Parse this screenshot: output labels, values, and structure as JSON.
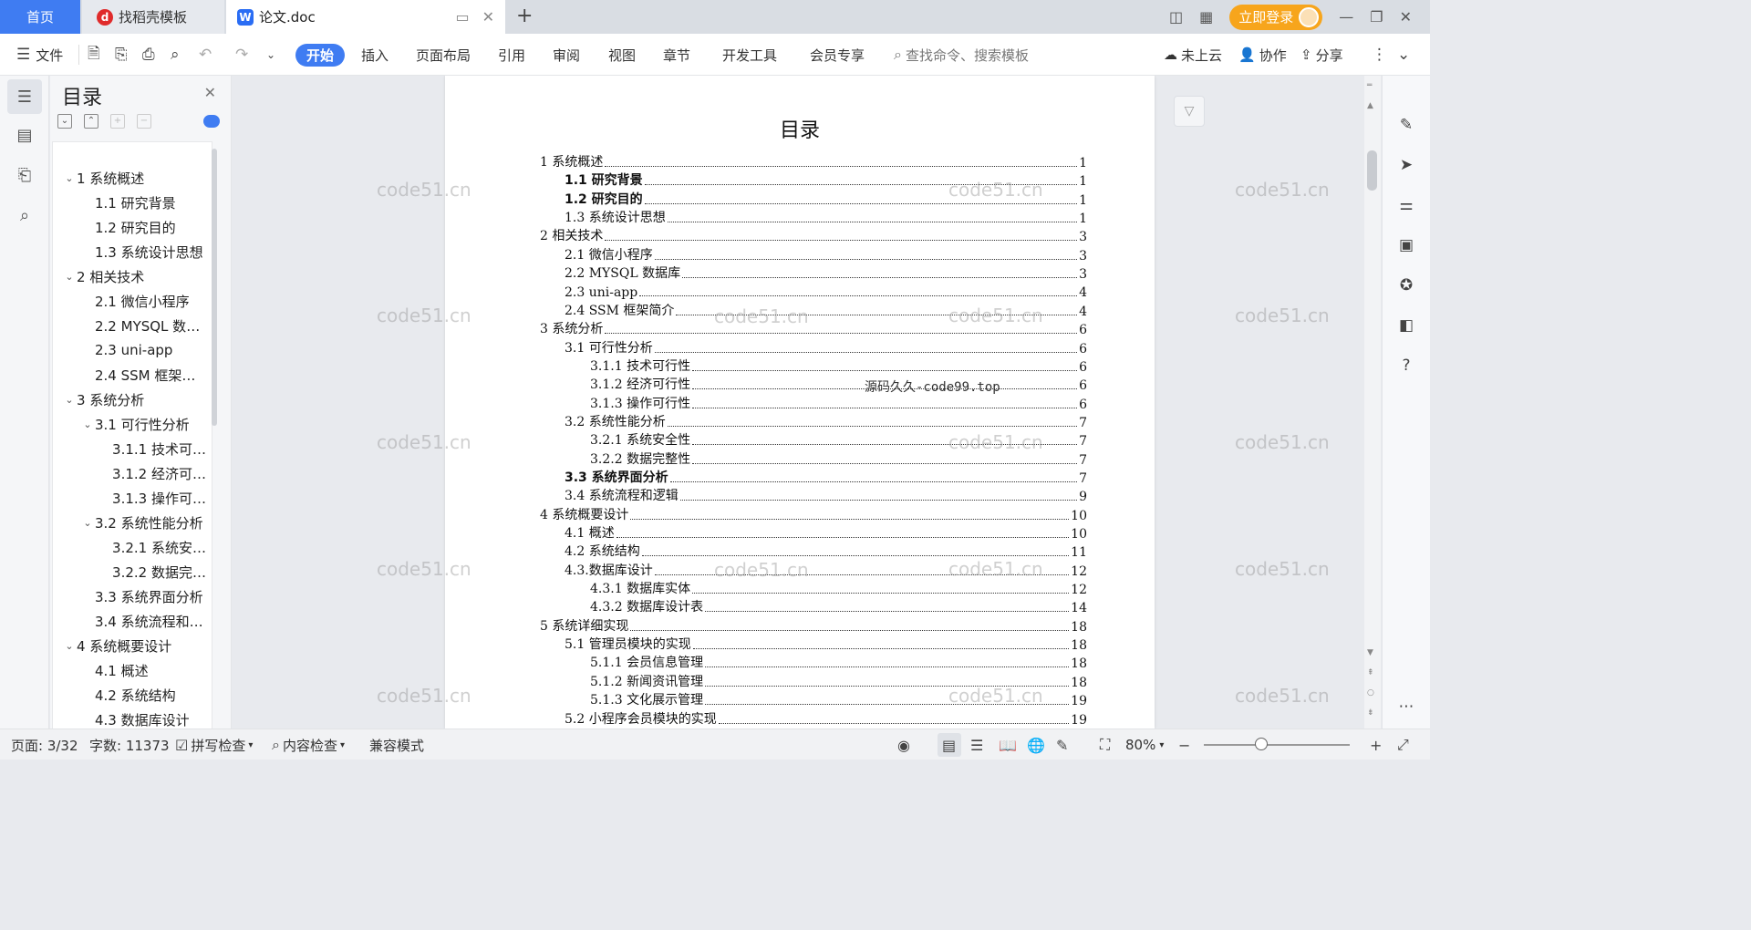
{
  "tabs": {
    "home": "首页",
    "template": "找稻壳模板",
    "doc": "论文.doc",
    "login": "立即登录"
  },
  "toolbar": {
    "file": "文件",
    "menus": [
      "开始",
      "插入",
      "页面布局",
      "引用",
      "审阅",
      "视图",
      "章节",
      "开发工具",
      "会员专享"
    ],
    "search_placeholder": "查找命令、搜索模板",
    "cloud": "未上云",
    "collab": "协作",
    "share": "分享"
  },
  "toc_panel": {
    "title": "目录",
    "items": [
      {
        "label": "1 系统概述",
        "level": 1,
        "expanded": true
      },
      {
        "label": "1.1  研究背景",
        "level": 2
      },
      {
        "label": "1.2 研究目的",
        "level": 2
      },
      {
        "label": "1.3 系统设计思想",
        "level": 2
      },
      {
        "label": "2 相关技术",
        "level": 1,
        "expanded": true
      },
      {
        "label": "2.1 微信小程序",
        "level": 2
      },
      {
        "label": "2.2 MYSQL 数据库",
        "level": 2
      },
      {
        "label": "2.3 uni-app",
        "level": 2
      },
      {
        "label": "2.4 SSM 框架简介",
        "level": 2
      },
      {
        "label": "3 系统分析",
        "level": 1,
        "expanded": true
      },
      {
        "label": "3.1 可行性分析",
        "level": 2,
        "expanded": true
      },
      {
        "label": "3.1.1 技术可行性",
        "level": 3
      },
      {
        "label": "3.1.2 经济可行性",
        "level": 3
      },
      {
        "label": "3.1.3 操作可行性",
        "level": 3
      },
      {
        "label": "3.2 系统性能分析",
        "level": 2,
        "expanded": true
      },
      {
        "label": "3.2.1  系统安全性",
        "level": 3
      },
      {
        "label": "3.2.2  数据完整性",
        "level": 3
      },
      {
        "label": "3.3 系统界面分析",
        "level": 2
      },
      {
        "label": "3.4 系统流程和逻辑",
        "level": 2
      },
      {
        "label": "4 系统概要设计",
        "level": 1,
        "expanded": true
      },
      {
        "label": "4.1 概述",
        "level": 2
      },
      {
        "label": "4.2 系统结构",
        "level": 2
      },
      {
        "label": "4.3 数据库设计",
        "level": 2
      }
    ]
  },
  "document": {
    "title": "目录",
    "entries": [
      {
        "text": "1 系统概述",
        "page": "1",
        "indent": 0,
        "bold": false
      },
      {
        "text": "1.1  研究背景",
        "page": "1",
        "indent": 1,
        "bold": true
      },
      {
        "text": "1.2 研究目的",
        "page": "1",
        "indent": 1,
        "bold": true
      },
      {
        "text": "1.3 系统设计思想",
        "page": "1",
        "indent": 1,
        "bold": false
      },
      {
        "text": "2 相关技术",
        "page": "3",
        "indent": 0,
        "bold": false
      },
      {
        "text": "2.1 微信小程序",
        "page": "3",
        "indent": 1,
        "bold": false
      },
      {
        "text": "2.2 MYSQL 数据库",
        "page": "3",
        "indent": 1,
        "bold": false
      },
      {
        "text": "2.3 uni-app",
        "page": "4",
        "indent": 1,
        "bold": false
      },
      {
        "text": "2.4 SSM 框架简介",
        "page": "4",
        "indent": 1,
        "bold": false
      },
      {
        "text": "3 系统分析",
        "page": "6",
        "indent": 0,
        "bold": false
      },
      {
        "text": "3.1 可行性分析",
        "page": "6",
        "indent": 1,
        "bold": false
      },
      {
        "text": "3.1.1 技术可行性",
        "page": "6",
        "indent": 2,
        "bold": false
      },
      {
        "text": "3.1.2 经济可行性",
        "page": "6",
        "indent": 2,
        "bold": false
      },
      {
        "text": "3.1.3 操作可行性",
        "page": "6",
        "indent": 2,
        "bold": false
      },
      {
        "text": "3.2 系统性能分析",
        "page": "7",
        "indent": 1,
        "bold": false
      },
      {
        "text": "3.2.1  系统安全性",
        "page": "7",
        "indent": 2,
        "bold": false
      },
      {
        "text": "3.2.2  数据完整性",
        "page": "7",
        "indent": 2,
        "bold": false
      },
      {
        "text": "3.3 系统界面分析",
        "page": "7",
        "indent": 1,
        "bold": true
      },
      {
        "text": "3.4 系统流程和逻辑",
        "page": "9",
        "indent": 1,
        "bold": false
      },
      {
        "text": "4 系统概要设计",
        "page": "10",
        "indent": 0,
        "bold": false
      },
      {
        "text": "4.1 概述",
        "page": "10",
        "indent": 1,
        "bold": false
      },
      {
        "text": "4.2 系统结构",
        "page": "11",
        "indent": 1,
        "bold": false
      },
      {
        "text": "4.3.数据库设计",
        "page": "12",
        "indent": 1,
        "bold": false
      },
      {
        "text": "4.3.1 数据库实体",
        "page": "12",
        "indent": 2,
        "bold": false
      },
      {
        "text": "4.3.2 数据库设计表",
        "page": "14",
        "indent": 2,
        "bold": false
      },
      {
        "text": "5 系统详细实现",
        "page": "18",
        "indent": 0,
        "bold": false
      },
      {
        "text": "5.1  管理员模块的实现",
        "page": "18",
        "indent": 1,
        "bold": false
      },
      {
        "text": "5.1.1  会员信息管理",
        "page": "18",
        "indent": 2,
        "bold": false
      },
      {
        "text": "5.1.2  新闻资讯管理",
        "page": "18",
        "indent": 2,
        "bold": false
      },
      {
        "text": "5.1.3  文化展示管理",
        "page": "19",
        "indent": 2,
        "bold": false
      },
      {
        "text": "5.2  小程序会员模块的实现",
        "page": "19",
        "indent": 1,
        "bold": false
      }
    ],
    "overlay": "源码久久-code99.top",
    "watermark": "code51.cn"
  },
  "status": {
    "page": "页面: 3/32",
    "words": "字数: 11373",
    "spell": "拼写检查",
    "content_check": "内容检查",
    "compat": "兼容模式",
    "zoom": "80%"
  }
}
